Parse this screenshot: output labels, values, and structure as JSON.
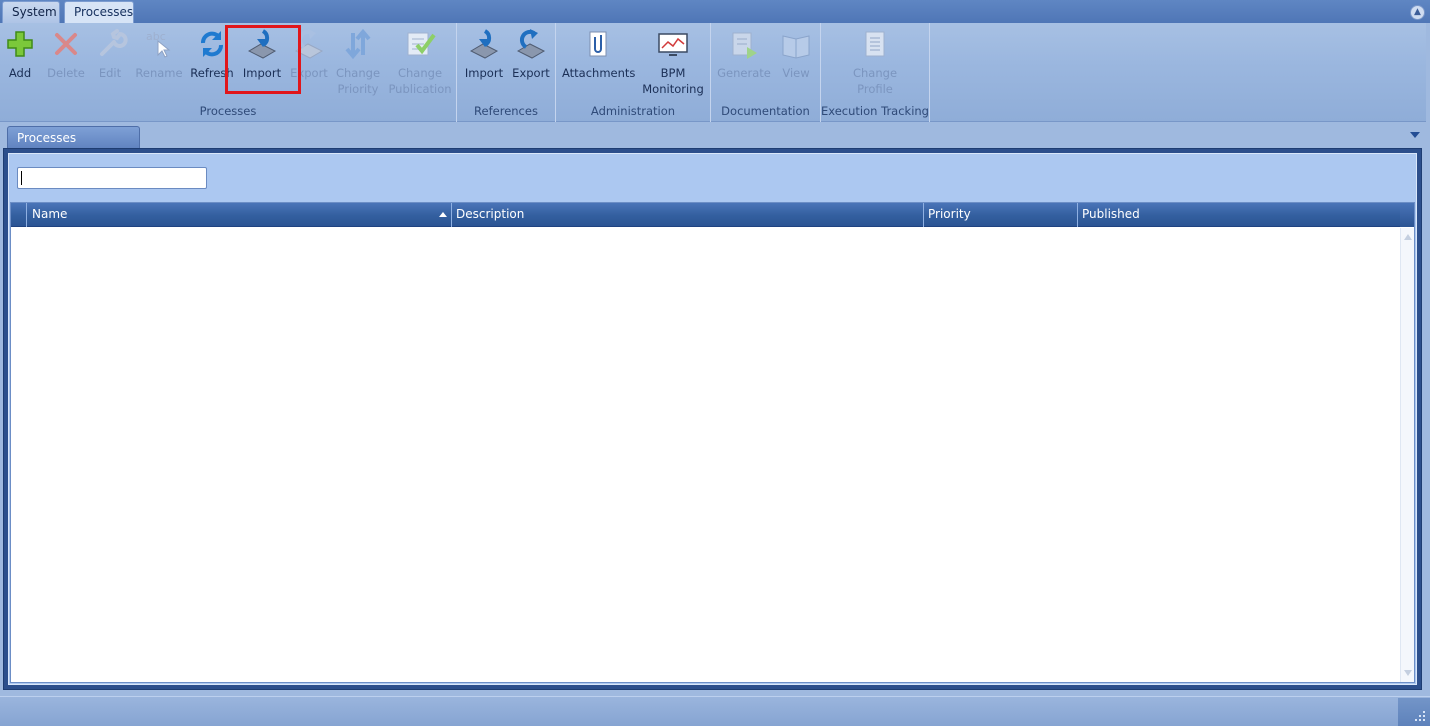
{
  "ribbon_tabs": [
    "System",
    "Processes"
  ],
  "active_ribbon_tab": "Processes",
  "groups": {
    "processes": {
      "label": "Processes",
      "buttons": {
        "add": "Add",
        "delete": "Delete",
        "edit": "Edit",
        "rename": "Rename",
        "refresh": "Refresh",
        "import": "Import",
        "export": "Export",
        "change_priority_1": "Change",
        "change_priority_2": "Priority",
        "change_publication_1": "Change",
        "change_publication_2": "Publication"
      }
    },
    "references": {
      "label": "References",
      "buttons": {
        "import": "Import",
        "export": "Export"
      }
    },
    "administration": {
      "label": "Administration",
      "buttons": {
        "attachments": "Attachments",
        "bpm_1": "BPM",
        "bpm_2": "Monitoring"
      }
    },
    "documentation": {
      "label": "Documentation",
      "buttons": {
        "generate": "Generate",
        "view": "View"
      }
    },
    "execution_tracking": {
      "label": "Execution Tracking",
      "buttons": {
        "change_profile_1": "Change",
        "change_profile_2": "Profile"
      }
    }
  },
  "document_tab": "Processes",
  "search": {
    "value": "",
    "placeholder": ""
  },
  "grid": {
    "columns": [
      "Name",
      "Description",
      "Priority",
      "Published"
    ],
    "sorted_column": "Name",
    "sort_direction": "ascending",
    "rows": []
  },
  "colors": {
    "highlight": "#e0161b",
    "header": "#335f9f",
    "ribbon": "#9bb7df"
  }
}
